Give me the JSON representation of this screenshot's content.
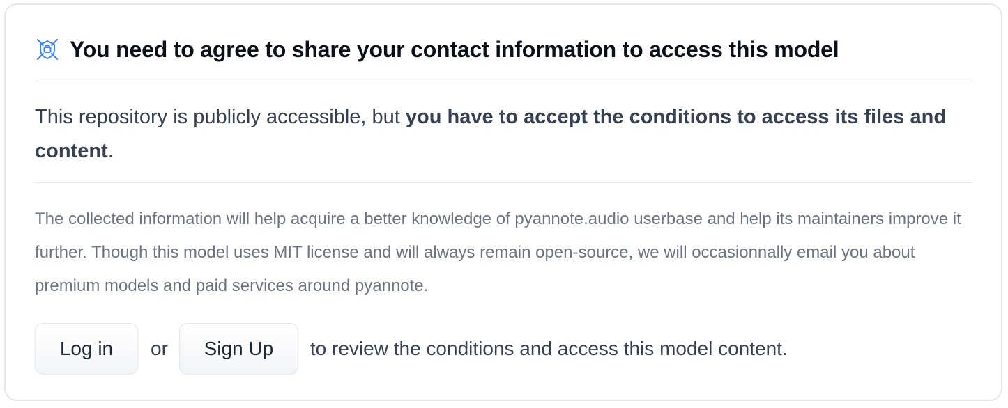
{
  "gate": {
    "icon": "gated-shield-icon",
    "title": "You need to agree to share your contact information to access this model",
    "lead_plain": "This repository is publicly accessible, but ",
    "lead_bold": "you have to accept the conditions to access its files and content",
    "lead_end": ".",
    "description": "The collected information will help acquire a better knowledge of pyannote.audio userbase and help its maintainers improve it further. Though this model uses MIT license and will always remain open-source, we will occasionnally email you about premium models and paid services around pyannote.",
    "login_label": "Log in",
    "or_text": "or",
    "signup_label": "Sign Up",
    "tail_text": "to review the conditions and access this model content."
  },
  "colors": {
    "accent_icon": "#3b82f6",
    "title_text": "#0b0f19",
    "muted_text": "#6b7280",
    "border": "#e5e7eb"
  }
}
